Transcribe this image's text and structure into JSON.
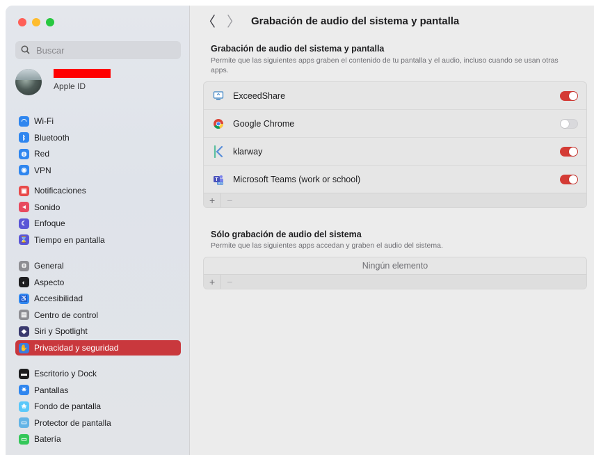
{
  "window": {
    "traffic_lights": [
      "close",
      "minimize",
      "maximize"
    ]
  },
  "sidebar": {
    "search_placeholder": "Buscar",
    "account": {
      "subtitle": "Apple ID"
    },
    "groups": [
      [
        {
          "label": "Wi-Fi",
          "icon": "wifi-icon",
          "color": "#2f86ef",
          "glyph": "◠"
        },
        {
          "label": "Bluetooth",
          "icon": "bluetooth-icon",
          "color": "#2f86ef",
          "glyph": "ᛒ"
        },
        {
          "label": "Red",
          "icon": "globe-icon",
          "color": "#2f86ef",
          "glyph": "◍"
        },
        {
          "label": "VPN",
          "icon": "vpn-icon",
          "color": "#2f86ef",
          "glyph": "◉"
        }
      ],
      [
        {
          "label": "Notificaciones",
          "icon": "notifications-icon",
          "color": "#e84a4a",
          "glyph": "▣"
        },
        {
          "label": "Sonido",
          "icon": "sound-icon",
          "color": "#e84a5f",
          "glyph": "◂"
        },
        {
          "label": "Enfoque",
          "icon": "focus-moon-icon",
          "color": "#5a55d6",
          "glyph": "☾"
        },
        {
          "label": "Tiempo en pantalla",
          "icon": "hourglass-icon",
          "color": "#5a55d6",
          "glyph": "⌛"
        }
      ],
      [
        {
          "label": "General",
          "icon": "gear-icon",
          "color": "#8e8e93",
          "glyph": "⚙"
        },
        {
          "label": "Aspecto",
          "icon": "appearance-icon",
          "color": "#1d1d1f",
          "glyph": "◐"
        },
        {
          "label": "Accesibilidad",
          "icon": "accessibility-icon",
          "color": "#2f86ef",
          "glyph": "♿"
        },
        {
          "label": "Centro de control",
          "icon": "control-center-icon",
          "color": "#8e8e93",
          "glyph": "▤"
        },
        {
          "label": "Siri y Spotlight",
          "icon": "siri-icon",
          "color": "#3a3a6e",
          "glyph": "◆"
        },
        {
          "label": "Privacidad y seguridad",
          "icon": "hand-icon",
          "color": "#3a7de0",
          "glyph": "✋",
          "selected": true
        }
      ],
      [
        {
          "label": "Escritorio y Dock",
          "icon": "dock-icon",
          "color": "#1d1d1f",
          "glyph": "▬"
        },
        {
          "label": "Pantallas",
          "icon": "displays-icon",
          "color": "#2f86ef",
          "glyph": "✷"
        },
        {
          "label": "Fondo de pantalla",
          "icon": "wallpaper-icon",
          "color": "#5ac8fa",
          "glyph": "❀"
        },
        {
          "label": "Protector de pantalla",
          "icon": "screensaver-icon",
          "color": "#64b4e6",
          "glyph": "▭"
        },
        {
          "label": "Batería",
          "icon": "battery-icon",
          "color": "#34c759",
          "glyph": "▭"
        }
      ]
    ]
  },
  "main": {
    "back_glyph": "〈",
    "forward_glyph": "〉",
    "page_title": "Grabación de audio del sistema y pantalla",
    "section1": {
      "title": "Grabación de audio del sistema y pantalla",
      "description": "Permite que las siguientes apps graben el contenido de tu pantalla y el audio, incluso cuando se usan otras apps.",
      "apps": [
        {
          "name": "ExceedShare",
          "icon": "exceedshare-icon",
          "enabled": true
        },
        {
          "name": "Google Chrome",
          "icon": "chrome-icon",
          "enabled": false
        },
        {
          "name": "klarway",
          "icon": "klarway-icon",
          "enabled": true
        },
        {
          "name": "Microsoft Teams (work or school)",
          "icon": "teams-icon",
          "enabled": true
        }
      ]
    },
    "section2": {
      "title": "Sólo grabación de audio del sistema",
      "description": "Permite que las siguientes apps accedan y graben el audio del sistema.",
      "empty_text": "Ningún elemento"
    },
    "add_glyph": "+",
    "remove_glyph": "−"
  }
}
